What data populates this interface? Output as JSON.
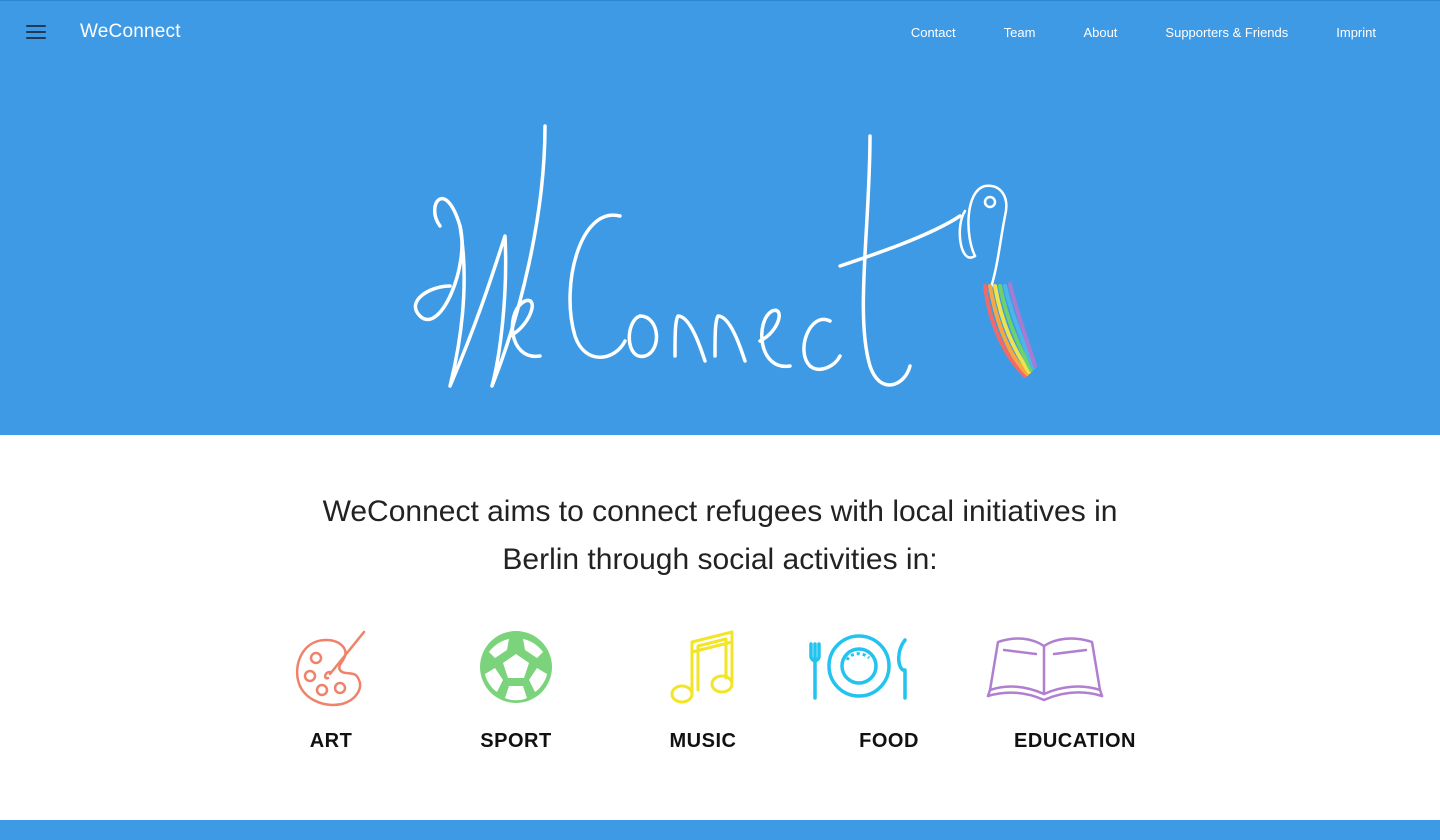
{
  "navbar": {
    "brand": "WeConnect",
    "links": [
      "Contact",
      "Team",
      "About",
      "Supporters & Friends",
      "Imprint"
    ]
  },
  "hero": {
    "logo_text": "WeConnect"
  },
  "intro": {
    "line1": "WeConnect aims to connect refugees with local initiatives in",
    "line2": "Berlin through social activities in:"
  },
  "activities": [
    {
      "label": "ART",
      "icon": "palette-icon",
      "color": "#f0826a"
    },
    {
      "label": "SPORT",
      "icon": "soccer-ball-icon",
      "color": "#7bd47b"
    },
    {
      "label": "MUSIC",
      "icon": "music-note-icon",
      "color": "#f2e527"
    },
    {
      "label": "FOOD",
      "icon": "plate-cutlery-icon",
      "color": "#22c3ee"
    },
    {
      "label": "EDUCATION",
      "icon": "book-icon",
      "color": "#b07fd0"
    }
  ],
  "colors": {
    "brand_blue": "#3e9ae4",
    "text": "#222222"
  }
}
